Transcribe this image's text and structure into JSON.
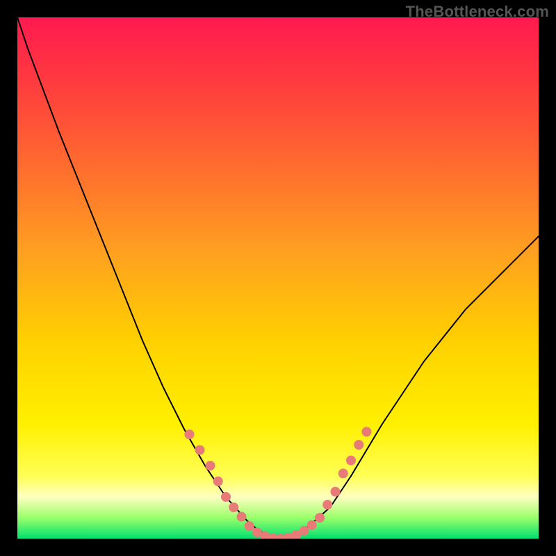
{
  "watermark": "TheBottleneck.com",
  "colors": {
    "page_bg": "#000000",
    "gradient_top": "#ff1a4f",
    "gradient_mid": "#ffd000",
    "gradient_bottom": "#00e070",
    "curve_stroke": "#000000",
    "marker_fill": "#e87a78"
  },
  "chart_data": {
    "type": "line",
    "title": "",
    "xlabel": "",
    "ylabel": "",
    "xlim": [
      0,
      100
    ],
    "ylim": [
      0,
      100
    ],
    "x": [
      0,
      2,
      5,
      8,
      12,
      16,
      20,
      24,
      28,
      32,
      36,
      40,
      44,
      46,
      48,
      50,
      52,
      54,
      56,
      60,
      64,
      70,
      78,
      86,
      94,
      100
    ],
    "y": [
      100,
      94,
      86,
      78,
      68,
      58,
      48,
      38,
      29,
      21,
      14,
      8,
      3.5,
      1.8,
      0.6,
      0,
      0.2,
      1.0,
      2.5,
      6,
      12,
      22,
      34,
      44,
      52,
      58
    ],
    "annotations": [
      {
        "x": 33,
        "y": 20
      },
      {
        "x": 35,
        "y": 17
      },
      {
        "x": 37,
        "y": 14
      },
      {
        "x": 38.5,
        "y": 11
      },
      {
        "x": 40,
        "y": 8
      },
      {
        "x": 41.5,
        "y": 6
      },
      {
        "x": 43,
        "y": 4.2
      },
      {
        "x": 44.5,
        "y": 2.4
      },
      {
        "x": 46,
        "y": 1.2
      },
      {
        "x": 47.5,
        "y": 0.5
      },
      {
        "x": 49,
        "y": 0.1
      },
      {
        "x": 50.5,
        "y": 0.0
      },
      {
        "x": 52,
        "y": 0.2
      },
      {
        "x": 53.5,
        "y": 0.7
      },
      {
        "x": 55,
        "y": 1.5
      },
      {
        "x": 56.5,
        "y": 2.6
      },
      {
        "x": 58,
        "y": 4.0
      },
      {
        "x": 59.5,
        "y": 6.5
      },
      {
        "x": 61,
        "y": 9.0
      },
      {
        "x": 62.5,
        "y": 12.5
      },
      {
        "x": 64,
        "y": 15.0
      },
      {
        "x": 65.5,
        "y": 18.0
      },
      {
        "x": 67,
        "y": 20.5
      }
    ]
  }
}
